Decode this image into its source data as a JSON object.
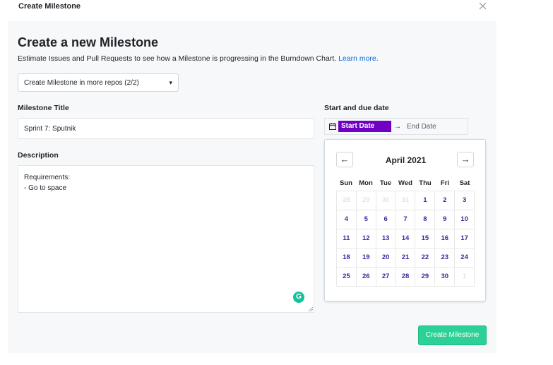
{
  "modal": {
    "title": "Create Milestone"
  },
  "header": {
    "heading": "Create a new Milestone",
    "subtext": "Estimate Issues and Pull Requests to see how a Milestone is progressing in the Burndown Chart.",
    "learn_more": "Learn more."
  },
  "repo_dropdown": {
    "label": "Create Milestone in more repos (2/2)"
  },
  "title_field": {
    "label": "Milestone Title",
    "value": "Sprint 7: Sputnik"
  },
  "description_field": {
    "label": "Description",
    "value": "Requirements:\n- Go to space"
  },
  "date_picker": {
    "label": "Start and due date",
    "start_label": "Start Date",
    "end_label": "End Date",
    "month": "April 2021",
    "weekdays": [
      "Sun",
      "Mon",
      "Tue",
      "Wed",
      "Thu",
      "Fri",
      "Sat"
    ],
    "weeks": [
      [
        {
          "d": "28",
          "m": true
        },
        {
          "d": "29",
          "m": true
        },
        {
          "d": "30",
          "m": true
        },
        {
          "d": "31",
          "m": true
        },
        {
          "d": "1",
          "m": false
        },
        {
          "d": "2",
          "m": false
        },
        {
          "d": "3",
          "m": false
        }
      ],
      [
        {
          "d": "4",
          "m": false
        },
        {
          "d": "5",
          "m": false
        },
        {
          "d": "6",
          "m": false
        },
        {
          "d": "7",
          "m": false
        },
        {
          "d": "8",
          "m": false
        },
        {
          "d": "9",
          "m": false
        },
        {
          "d": "10",
          "m": false
        }
      ],
      [
        {
          "d": "11",
          "m": false
        },
        {
          "d": "12",
          "m": false
        },
        {
          "d": "13",
          "m": false
        },
        {
          "d": "14",
          "m": false
        },
        {
          "d": "15",
          "m": false
        },
        {
          "d": "16",
          "m": false
        },
        {
          "d": "17",
          "m": false
        }
      ],
      [
        {
          "d": "18",
          "m": false
        },
        {
          "d": "19",
          "m": false
        },
        {
          "d": "20",
          "m": false
        },
        {
          "d": "21",
          "m": false
        },
        {
          "d": "22",
          "m": false
        },
        {
          "d": "23",
          "m": false
        },
        {
          "d": "24",
          "m": false
        }
      ],
      [
        {
          "d": "25",
          "m": false
        },
        {
          "d": "26",
          "m": false
        },
        {
          "d": "27",
          "m": false
        },
        {
          "d": "28",
          "m": false
        },
        {
          "d": "29",
          "m": false
        },
        {
          "d": "30",
          "m": false
        },
        {
          "d": "1",
          "m": true
        }
      ]
    ]
  },
  "footer": {
    "create_label": "Create Milestone"
  },
  "icons": {
    "close": "close-icon",
    "chevron": "chevron-down-icon",
    "calendar": "calendar-icon",
    "range_arrow": "arrow-right-icon",
    "prev": "arrow-left-icon",
    "next": "arrow-right-icon",
    "grammarly": "grammarly-icon",
    "resize": "resize-grip-icon"
  },
  "colors": {
    "accent_purple": "#6f00c4",
    "day_text": "#3a2a9f",
    "create_button": "#2cd197",
    "link": "#0969da"
  }
}
